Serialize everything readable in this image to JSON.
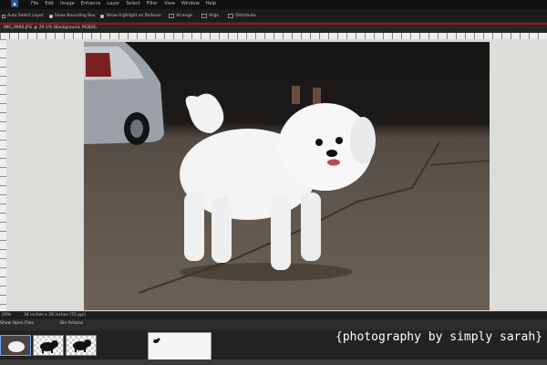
{
  "menubar": {
    "items": [
      "File",
      "Edit",
      "Image",
      "Enhance",
      "Layer",
      "Select",
      "Filter",
      "View",
      "Window",
      "Help"
    ]
  },
  "options_bar": {
    "auto_select_layer": "Auto Select Layer",
    "show_bounding_box": "Show Bounding Box",
    "show_highlight": "Show Highlight on Rollover",
    "arrange": "Arrange",
    "align": "Align",
    "distribute": "Distribute"
  },
  "document": {
    "tab_label": "IMG_9666.JPG @ 29.1% (Background, RGB/8)"
  },
  "status": {
    "zoom": "29%",
    "doc_size": "34 inches x 26 inches (72 ppi)"
  },
  "bin": {
    "select_label": "Show Open Files",
    "actions_label": "Bin Actions",
    "thumbnails": [
      "photo-thumbnail",
      "dog-silhouette-thumbnail",
      "dog-silhouette-thumbnail-2"
    ]
  },
  "watermark": "{photography by simply sarah}",
  "colors": {
    "accent_red": "#a01010",
    "ui_dark": "#1c1c1c",
    "pasteboard": "#dcdcd9"
  }
}
